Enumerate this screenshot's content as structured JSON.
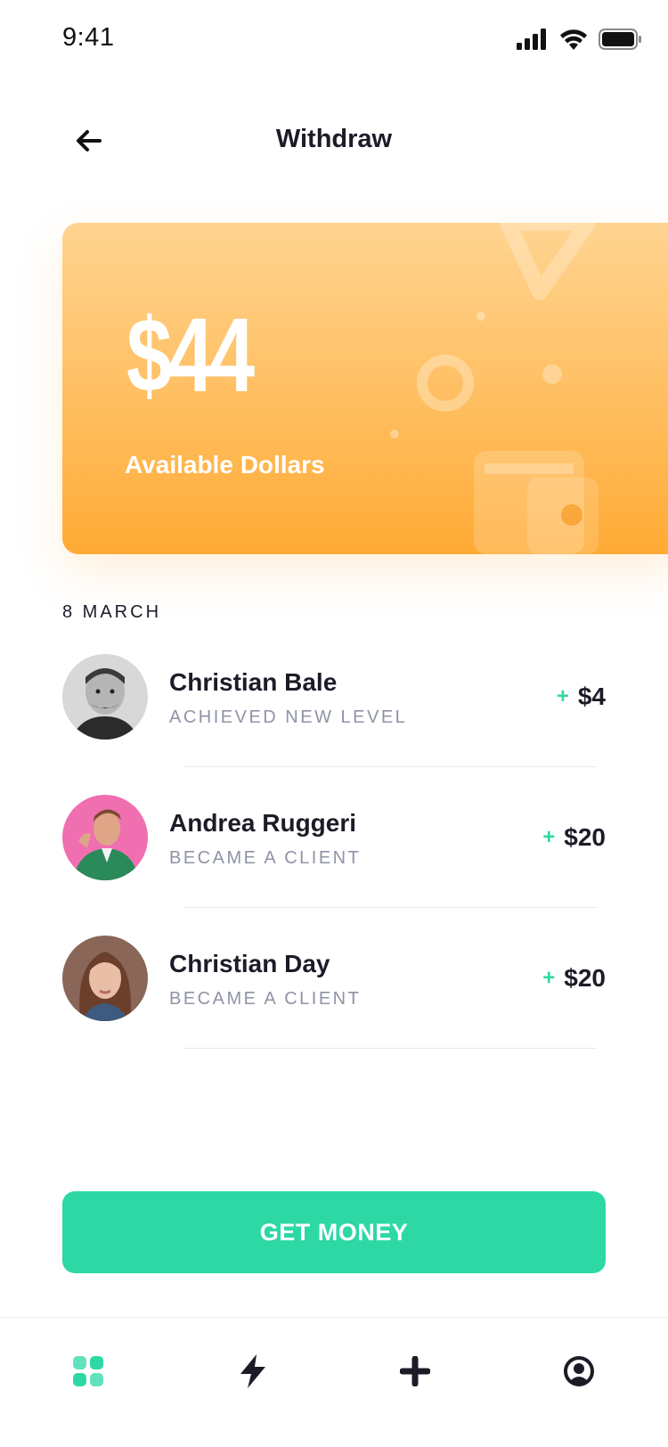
{
  "status_bar": {
    "time": "9:41",
    "icons": [
      "signal-icon",
      "wifi-icon",
      "battery-icon"
    ]
  },
  "header": {
    "title": "Withdraw",
    "back_icon": "arrow-left-icon"
  },
  "balance_card": {
    "amount": "$44",
    "label": "Available Dollars",
    "decoration_icon": "wallet-icon"
  },
  "section": {
    "date": "8 MARCH"
  },
  "transactions": [
    {
      "name": "Christian Bale",
      "description": "ACHIEVED NEW LEVEL",
      "sign": "+",
      "amount": "$4"
    },
    {
      "name": "Andrea Ruggeri",
      "description": "BECAME A CLIENT",
      "sign": "+",
      "amount": "$20"
    },
    {
      "name": "Christian Day",
      "description": "BECAME A CLIENT",
      "sign": "+",
      "amount": "$20"
    }
  ],
  "cta": {
    "label": "GET MONEY"
  },
  "tab_bar": {
    "items": [
      {
        "icon": "grid-icon",
        "active": true
      },
      {
        "icon": "lightning-icon",
        "active": false
      },
      {
        "icon": "plus-icon",
        "active": false
      },
      {
        "icon": "profile-icon",
        "active": false
      }
    ]
  },
  "colors": {
    "accent": "#2ed8a5",
    "card_top": "#ffd491",
    "card_bottom": "#ffab35",
    "text_primary": "#1c1c28",
    "text_secondary": "#8f93a6"
  }
}
